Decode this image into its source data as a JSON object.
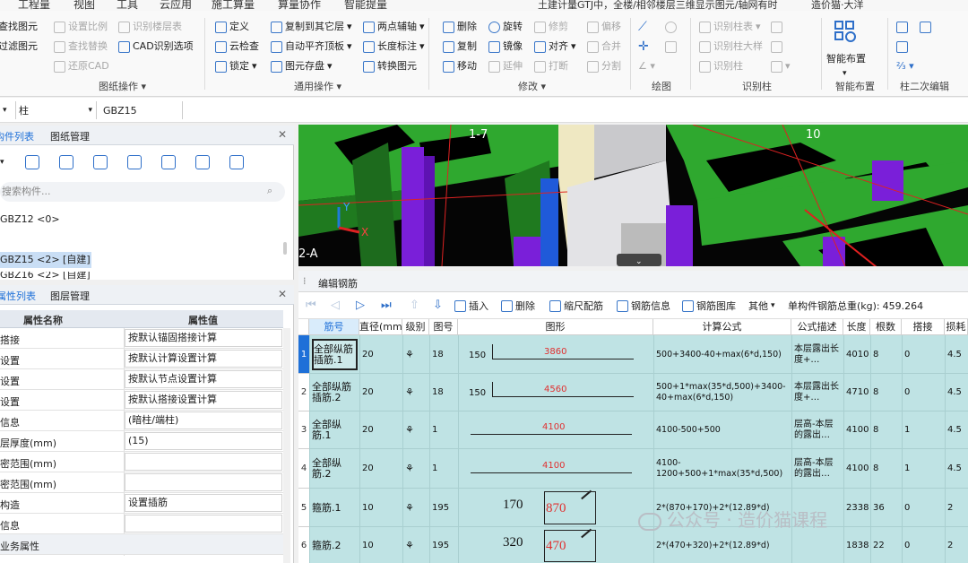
{
  "menu": {
    "items": [
      "工程量",
      "视图",
      "工具",
      "云应用",
      "施工算量",
      "算量协作",
      "智能提量"
    ],
    "title_hint": "土建计量GTJ中，全楼/相邻楼层三维显示图元/轴网有时",
    "title_user": "造价猫·大洋"
  },
  "ribbon": {
    "drawing_ops": {
      "items": [
        "查找图元",
        "设置比例",
        "识别楼层表",
        "过滤图元",
        "查找替换",
        "CAD识别选项",
        "还原CAD"
      ],
      "group": "图纸操作"
    },
    "general_ops": {
      "items": [
        "定义",
        "复制到其它层",
        "两点辅轴",
        "云检查",
        "自动平齐顶板",
        "长度标注",
        "锁定",
        "图元存盘",
        "转换图元"
      ],
      "group": "通用操作"
    },
    "modify": {
      "items": [
        "删除",
        "旋转",
        "修剪",
        "偏移",
        "复制",
        "镜像",
        "对齐",
        "合并",
        "移动",
        "延伸",
        "打断",
        "分割"
      ],
      "group": "修改"
    },
    "draw": {
      "group": "绘图"
    },
    "recognize_column": {
      "items": [
        "识别柱表",
        "识别柱大样",
        "识别柱"
      ],
      "group": "识别柱"
    },
    "smart_layout": {
      "label": "智能布置",
      "group": "智能布置"
    },
    "column_edit": {
      "group": "柱二次编辑"
    }
  },
  "selector": {
    "layer": "",
    "type": "柱",
    "component": "GBZ15"
  },
  "component_panel": {
    "tabs": [
      "构件列表",
      "图纸管理"
    ],
    "search_placeholder": "搜索构件...",
    "items": [
      "GBZ12 <0>",
      "GBZ15 <2> [自建]",
      "GBZ16 <2> [自建]"
    ]
  },
  "property_panel": {
    "tabs": [
      "属性列表",
      "图层管理"
    ],
    "headers": [
      "属性名称",
      "属性值"
    ],
    "rows": [
      {
        "name": "搭接",
        "value": "按默认锚固搭接计算"
      },
      {
        "name": "设置",
        "value": "按默认计算设置计算"
      },
      {
        "name": "设置",
        "value": "按默认节点设置计算"
      },
      {
        "name": "设置",
        "value": "按默认搭接设置计算"
      },
      {
        "name": "信息",
        "value": "(暗柱/端柱)"
      },
      {
        "name": "层厚度(mm)",
        "value": "(15)"
      },
      {
        "name": "密范围(mm)",
        "value": ""
      },
      {
        "name": "密范围(mm)",
        "value": ""
      },
      {
        "name": "构造",
        "value": "设置插筋"
      },
      {
        "name": "信息",
        "value": ""
      },
      {
        "name": "业务属性",
        "value": ""
      }
    ]
  },
  "view3d": {
    "labels": [
      "1-7",
      "10",
      "2-A"
    ],
    "axis_x": "X",
    "axis_y": "Y"
  },
  "editor": {
    "title": "编辑钢筋",
    "toolbar": {
      "insert": "插入",
      "delete": "删除",
      "scale": "缩尺配筋",
      "info": "钢筋信息",
      "lib": "钢筋图库",
      "other": "其他",
      "total_label": "单构件钢筋总重(kg):",
      "total_value": "459.264"
    },
    "headers": [
      "筋号",
      "直径(mm)",
      "级别",
      "图号",
      "图形",
      "计算公式",
      "公式描述",
      "长度",
      "根数",
      "搭接",
      "损耗"
    ],
    "rows": [
      {
        "no": "1",
        "name": "全部纵筋插筋.1",
        "dia": "20",
        "grade": "⚘",
        "fig": "18",
        "shape_left": "150",
        "shape_mid": "3860",
        "formula": "500+3400-40+max(6*d,150)",
        "desc": "本层露出长度+…",
        "len": "4010",
        "count": "8",
        "lap": "0",
        "loss": "4.5"
      },
      {
        "no": "2",
        "name": "全部纵筋插筋.2",
        "dia": "20",
        "grade": "⚘",
        "fig": "18",
        "shape_left": "150",
        "shape_mid": "4560",
        "formula": "500+1*max(35*d,500)+3400-40+max(6*d,150)",
        "desc": "本层露出长度+…",
        "len": "4710",
        "count": "8",
        "lap": "0",
        "loss": "4.5"
      },
      {
        "no": "3",
        "name": "全部纵筋.1",
        "dia": "20",
        "grade": "⚘",
        "fig": "1",
        "shape_left": "",
        "shape_mid": "4100",
        "formula": "4100-500+500",
        "desc": "层高-本层的露出…",
        "len": "4100",
        "count": "8",
        "lap": "1",
        "loss": "4.5"
      },
      {
        "no": "4",
        "name": "全部纵筋.2",
        "dia": "20",
        "grade": "⚘",
        "fig": "1",
        "shape_left": "",
        "shape_mid": "4100",
        "formula": "4100-1200+500+1*max(35*d,500)",
        "desc": "层高-本层的露出…",
        "len": "4100",
        "count": "8",
        "lap": "1",
        "loss": "4.5"
      },
      {
        "no": "5",
        "name": "箍筋.1",
        "dia": "10",
        "grade": "⚘",
        "fig": "195",
        "shape_left": "170",
        "shape_mid": "870",
        "formula": "2*(870+170)+2*(12.89*d)",
        "desc": "",
        "len": "2338",
        "count": "36",
        "lap": "0",
        "loss": "2"
      },
      {
        "no": "6",
        "name": "箍筋.2",
        "dia": "10",
        "grade": "⚘",
        "fig": "195",
        "shape_left": "320",
        "shape_mid": "470",
        "formula": "2*(470+320)+2*(12.89*d)",
        "desc": "",
        "len": "1838",
        "count": "22",
        "lap": "0",
        "loss": "2"
      }
    ]
  },
  "watermark": "公众号 · 造价猫课程"
}
